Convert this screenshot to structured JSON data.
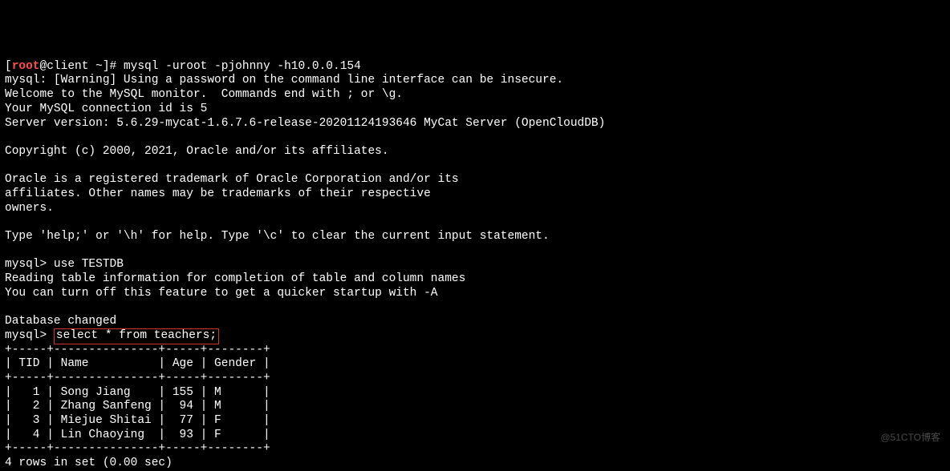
{
  "prompt": {
    "user": "root",
    "host": "client",
    "path": "~",
    "symbol": "#"
  },
  "command": "mysql -uroot -pjohnny -h10.0.0.154",
  "banner": {
    "l1": "mysql: [Warning] Using a password on the command line interface can be insecure.",
    "l2": "Welcome to the MySQL monitor.  Commands end with ; or \\g.",
    "l3": "Your MySQL connection id is 5",
    "l4": "Server version: 5.6.29-mycat-1.6.7.6-release-20201124193646 MyCat Server (OpenCloudDB)",
    "l5": "Copyright (c) 2000, 2021, Oracle and/or its affiliates.",
    "l6": "Oracle is a registered trademark of Oracle Corporation and/or its",
    "l7": "affiliates. Other names may be trademarks of their respective",
    "l8": "owners.",
    "l9": "Type 'help;' or '\\h' for help. Type '\\c' to clear the current input statement."
  },
  "session": {
    "mysql_prompt": "mysql>",
    "use_cmd": "use TESTDB",
    "use_out1": "Reading table information for completion of table and column names",
    "use_out2": "You can turn off this feature to get a quicker startup with -A",
    "db_changed": "Database changed",
    "select_cmd": "select * from teachers;"
  },
  "table": {
    "border_top": "+-----+---------------+-----+--------+",
    "header_row": "| TID | Name          | Age | Gender |",
    "border_mid": "+-----+---------------+-----+--------+",
    "rows": [
      "|   1 | Song Jiang    | 155 | M      |",
      "|   2 | Zhang Sanfeng |  94 | M      |",
      "|   3 | Miejue Shitai |  77 | F      |",
      "|   4 | Lin Chaoying  |  93 | F      |"
    ],
    "border_bot": "+-----+---------------+-----+--------+",
    "footer": "4 rows in set (0.00 sec)"
  },
  "chart_data": {
    "type": "table",
    "columns": [
      "TID",
      "Name",
      "Age",
      "Gender"
    ],
    "rows": [
      {
        "TID": 1,
        "Name": "Song Jiang",
        "Age": 155,
        "Gender": "M"
      },
      {
        "TID": 2,
        "Name": "Zhang Sanfeng",
        "Age": 94,
        "Gender": "M"
      },
      {
        "TID": 3,
        "Name": "Miejue Shitai",
        "Age": 77,
        "Gender": "F"
      },
      {
        "TID": 4,
        "Name": "Lin Chaoying",
        "Age": 93,
        "Gender": "F"
      }
    ]
  },
  "watermark": "@51CTO博客"
}
